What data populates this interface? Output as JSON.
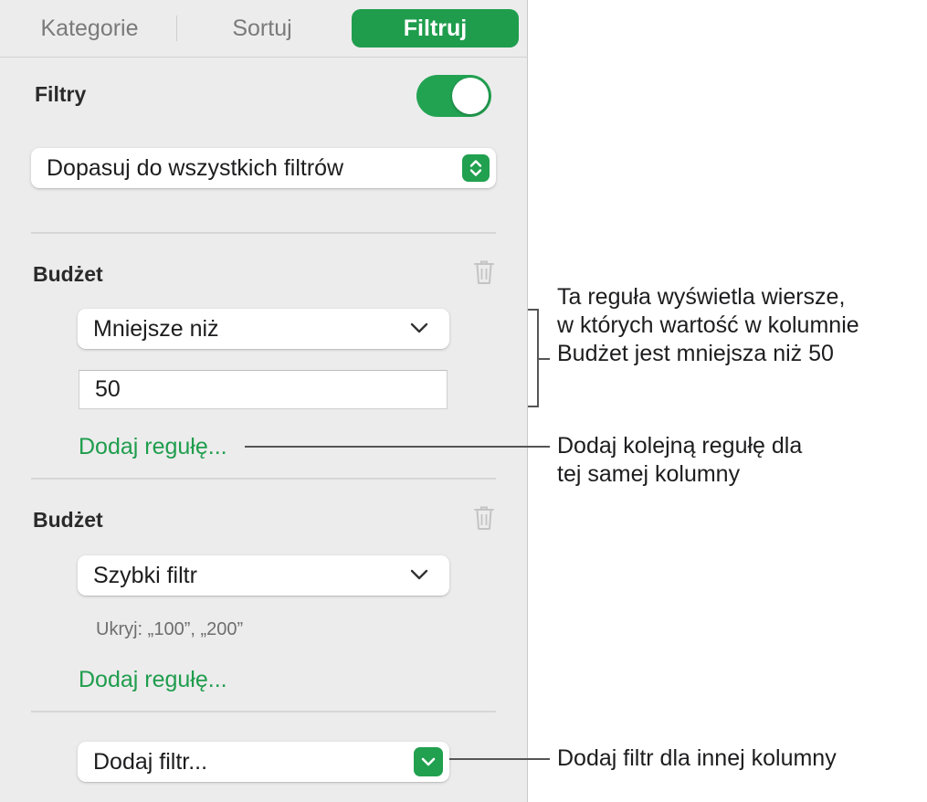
{
  "tabs": {
    "categories": "Kategorie",
    "sort": "Sortuj",
    "filter": "Filtruj"
  },
  "filters": {
    "title": "Filtry",
    "enabled": true,
    "match_mode": "Dopasuj do wszystkich filtrów"
  },
  "filter_groups": [
    {
      "column": "Budżet",
      "rule": "Mniejsze niż",
      "value": "50",
      "add_rule": "Dodaj regułę..."
    },
    {
      "column": "Budżet",
      "rule": "Szybki filtr",
      "hint": "Ukryj: „100”, „200”",
      "add_rule": "Dodaj regułę..."
    }
  ],
  "add_filter": "Dodaj filtr...",
  "callouts": {
    "rule_explanation": [
      "Ta reguła wyświetla wiersze,",
      "w których wartość w kolumnie",
      "Budżet jest mniejsza niż 50"
    ],
    "add_rule_explanation": [
      "Dodaj kolejną regułę dla",
      "tej samej kolumny"
    ],
    "add_filter_explanation": "Dodaj filtr dla innej kolumny"
  },
  "colors": {
    "accent": "#1f9d4d",
    "panel_bg": "#ececec"
  }
}
